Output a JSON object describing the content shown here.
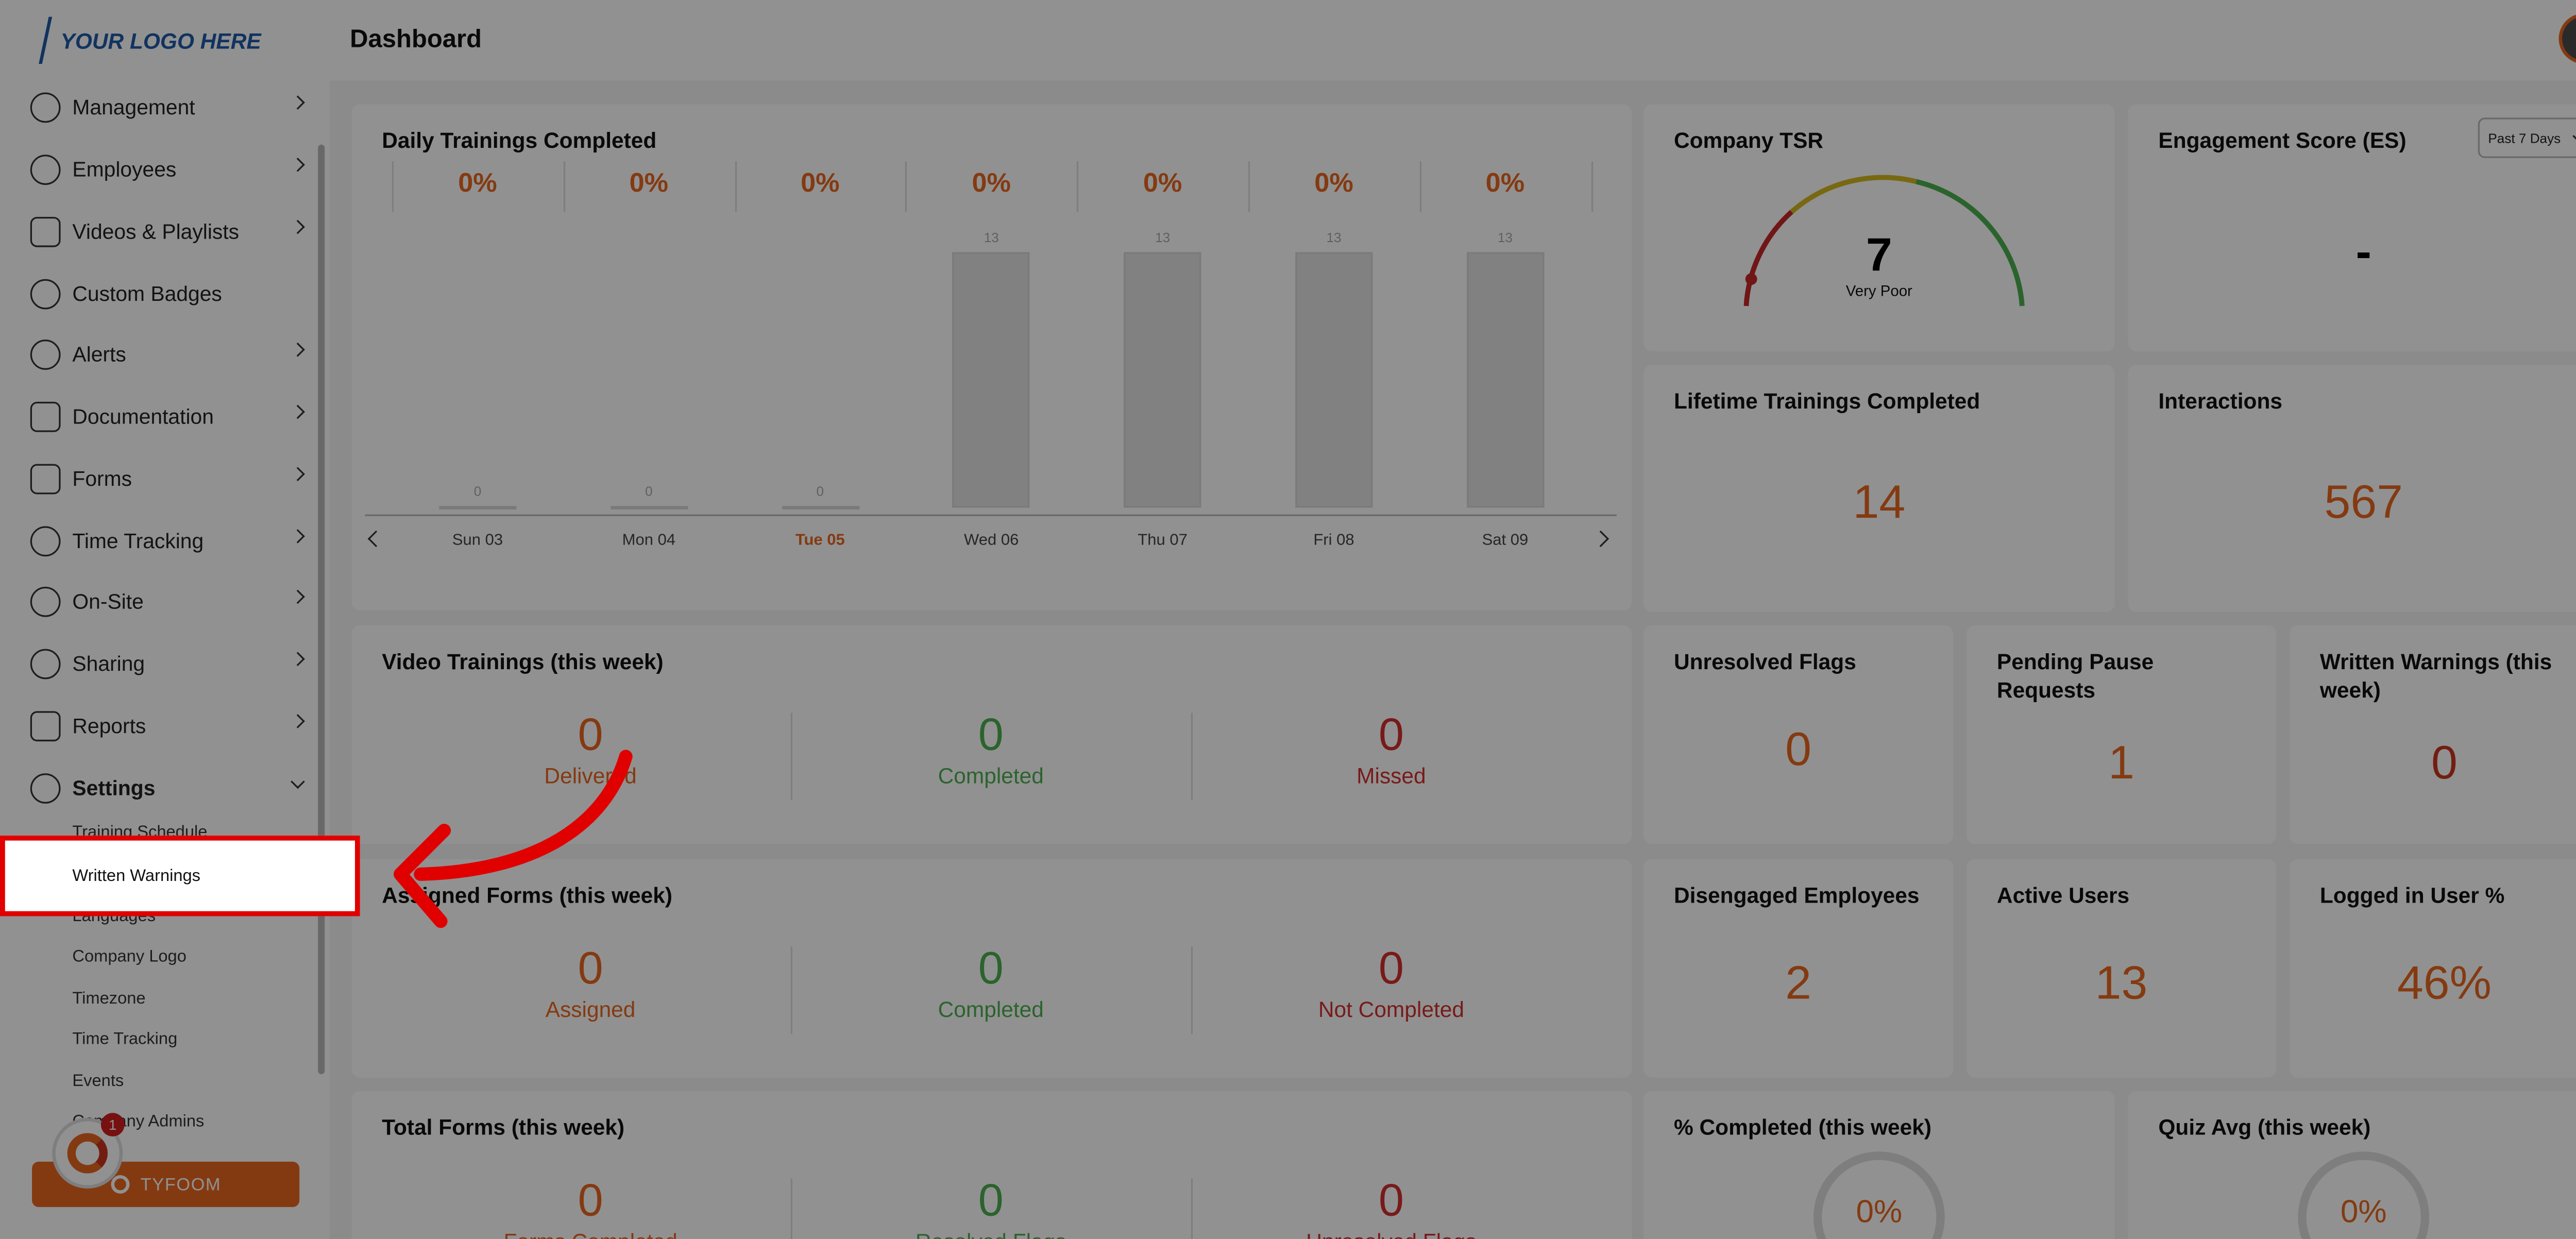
{
  "logo": {
    "text": "YOUR LOGO HERE"
  },
  "header": {
    "title": "Dashboard"
  },
  "sidebar": {
    "items": [
      {
        "label": "Management"
      },
      {
        "label": "Employees"
      },
      {
        "label": "Videos & Playlists"
      },
      {
        "label": "Custom Badges"
      },
      {
        "label": "Alerts"
      },
      {
        "label": "Documentation"
      },
      {
        "label": "Forms"
      },
      {
        "label": "Time Tracking"
      },
      {
        "label": "On-Site"
      },
      {
        "label": "Sharing"
      },
      {
        "label": "Reports"
      },
      {
        "label": "Settings"
      }
    ],
    "settings_sub": [
      {
        "label": "Training Schedule"
      },
      {
        "label": "Written Warnings"
      },
      {
        "label": "Languages"
      },
      {
        "label": "Company Logo"
      },
      {
        "label": "Timezone"
      },
      {
        "label": "Time Tracking"
      },
      {
        "label": "Events"
      },
      {
        "label": "Company Admins"
      }
    ],
    "tyfoom_button": "TYFOOM",
    "help_badge": "1"
  },
  "daily": {
    "title": "Daily Trainings Completed",
    "days": [
      {
        "pct": "0%",
        "label": "Sun 03",
        "value": "0",
        "bar": 0
      },
      {
        "pct": "0%",
        "label": "Mon 04",
        "value": "0",
        "bar": 0
      },
      {
        "pct": "0%",
        "label": "Tue 05",
        "value": "0",
        "bar": 0
      },
      {
        "pct": "0%",
        "label": "Wed 06",
        "value": "13",
        "bar": 13
      },
      {
        "pct": "0%",
        "label": "Thu 07",
        "value": "13",
        "bar": 13
      },
      {
        "pct": "0%",
        "label": "Fri 08",
        "value": "13",
        "bar": 13
      },
      {
        "pct": "0%",
        "label": "Sat 09",
        "value": "13",
        "bar": 13
      }
    ]
  },
  "company_tsr": {
    "title": "Company TSR",
    "value": "7",
    "rating": "Very Poor"
  },
  "engagement": {
    "title": "Engagement Score (ES)",
    "value": "-",
    "range": "Past 7 Days"
  },
  "lifetime": {
    "title": "Lifetime Trainings Completed",
    "value": "14"
  },
  "interactions": {
    "title": "Interactions",
    "value": "567"
  },
  "video_trainings": {
    "title": "Video Trainings (this week)",
    "delivered": "0",
    "delivered_label": "Delivered",
    "completed": "0",
    "completed_label": "Completed",
    "missed": "0",
    "missed_label": "Missed"
  },
  "unresolved": {
    "title": "Unresolved Flags",
    "value": "0"
  },
  "pause": {
    "title": "Pending Pause Requests",
    "value": "1"
  },
  "warnings": {
    "title": "Written Warnings (this week)",
    "value": "0"
  },
  "assigned_forms": {
    "title": "Assigned Forms (this week)",
    "assigned": "0",
    "assigned_label": "Assigned",
    "completed": "0",
    "completed_label": "Completed",
    "not_completed": "0",
    "not_completed_label": "Not Completed"
  },
  "disengaged": {
    "title": "Disengaged Employees",
    "value": "2"
  },
  "active_users": {
    "title": "Active Users",
    "value": "13"
  },
  "logged_in": {
    "title": "Logged in User %",
    "value": "46%"
  },
  "total_forms": {
    "title": "Total Forms (this week)",
    "a": "0",
    "a_label": "Forms Completed",
    "b": "0",
    "b_label": "Resolved Flags",
    "c": "0",
    "c_label": "Unresolved Flags"
  },
  "pct_completed": {
    "title": "% Completed (this week)",
    "value": "0%"
  },
  "quiz_avg": {
    "title": "Quiz Avg (this week)",
    "value": "0%"
  },
  "highlight": {
    "label": "Written Warnings"
  }
}
